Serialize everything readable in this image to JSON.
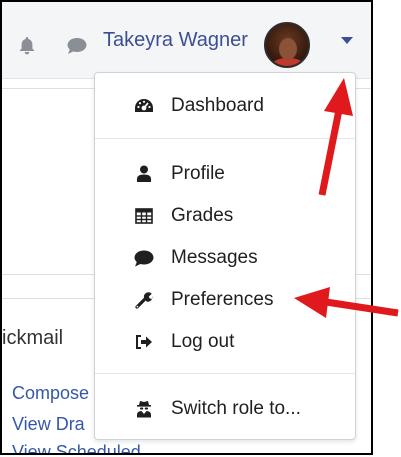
{
  "header": {
    "user_name": "Takeyra Wagner"
  },
  "user_menu": {
    "items": [
      {
        "label": "Dashboard",
        "icon": "dashboard-gauge-icon"
      },
      {
        "label": "Profile",
        "icon": "user-icon"
      },
      {
        "label": "Grades",
        "icon": "table-icon"
      },
      {
        "label": "Messages",
        "icon": "comment-icon"
      },
      {
        "label": "Preferences",
        "icon": "wrench-icon"
      },
      {
        "label": "Log out",
        "icon": "sign-out-icon"
      },
      {
        "label": "Switch role to...",
        "icon": "user-secret-icon"
      }
    ]
  },
  "background": {
    "block_title": "ickmail",
    "links": [
      "Compose",
      "View Dra",
      "View Scheduled"
    ]
  },
  "colors": {
    "accent": "#3c4f92",
    "annotation_arrow": "#e0191c",
    "link": "#3458a8"
  }
}
